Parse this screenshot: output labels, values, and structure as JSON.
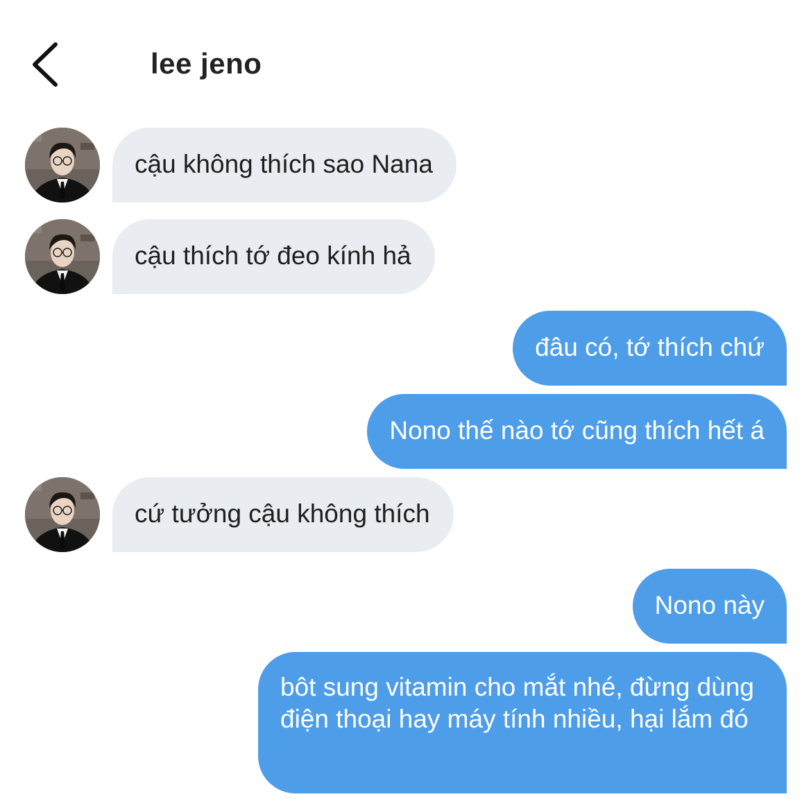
{
  "header": {
    "title": "lee jeno",
    "back_icon": "chevron-left-icon"
  },
  "colors": {
    "incoming_bubble": "#e9ecf0",
    "outgoing_bubble": "#4d9de8",
    "incoming_text": "#1e1e1e",
    "outgoing_text": "#ffffff"
  },
  "messages": [
    {
      "direction": "incoming",
      "text": "cậu không thích sao Nana"
    },
    {
      "direction": "incoming",
      "text": "cậu thích tớ đeo kính hả"
    },
    {
      "direction": "outgoing",
      "text": "đâu có, tớ thích chứ"
    },
    {
      "direction": "outgoing",
      "text": "Nono thế nào tớ cũng thích hết á"
    },
    {
      "direction": "incoming",
      "text": "cứ tưởng cậu không thích"
    },
    {
      "direction": "outgoing",
      "text": "Nono này"
    },
    {
      "direction": "outgoing",
      "text": "bôt sung vitamin cho mắt nhé, đừng dùng điện thoại hay máy tính nhiều, hại lắm đó"
    }
  ]
}
